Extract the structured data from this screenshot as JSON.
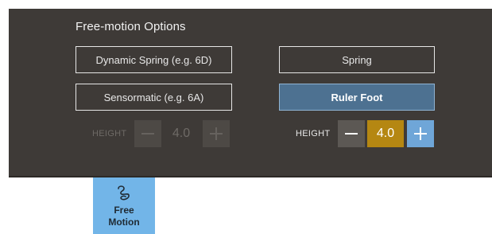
{
  "panel": {
    "title": "Free-motion Options",
    "options": [
      {
        "label": "Dynamic Spring (e.g. 6D)",
        "selected": false
      },
      {
        "label": "Spring",
        "selected": false
      },
      {
        "label": "Sensormatic (e.g. 6A)",
        "selected": false
      },
      {
        "label": "Ruler Foot",
        "selected": true
      }
    ],
    "left_height": {
      "label": "HEIGHT",
      "value": "4.0",
      "enabled": false
    },
    "right_height": {
      "label": "HEIGHT",
      "value": "4.0",
      "enabled": true
    }
  },
  "tile": {
    "label_line1": "Free",
    "label_line2": "Motion",
    "icon": "free-motion-squiggle-icon"
  },
  "colors": {
    "panel_bg": "#3e3a37",
    "selected_option": "#4d7191",
    "value_highlight": "#b58712",
    "plus_active": "#6fa6d8",
    "tile_bg": "#72b5e8"
  }
}
